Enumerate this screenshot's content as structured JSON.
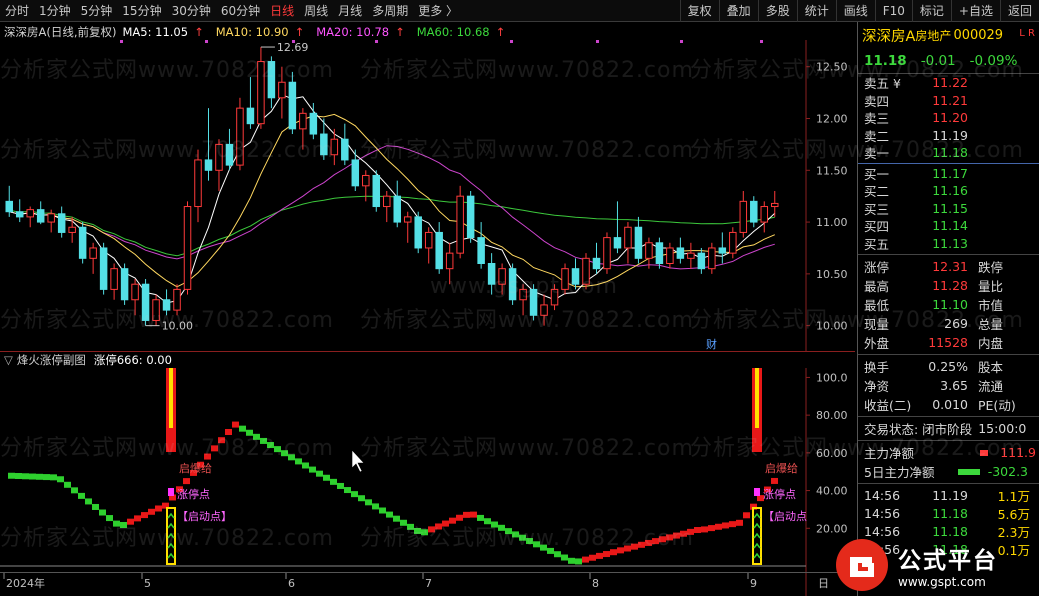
{
  "toolbar": {
    "periods": [
      "分时",
      "1分钟",
      "5分钟",
      "15分钟",
      "30分钟",
      "60分钟",
      "日线",
      "周线",
      "月线",
      "多周期",
      "更多 〉"
    ],
    "active_period": "日线",
    "buttons": [
      "复权",
      "叠加",
      "多股",
      "统计",
      "画线",
      "F10",
      "标记",
      "+自选",
      "返回"
    ]
  },
  "main_chart": {
    "title": "深深房A(日线,前复权)",
    "ma5": "MA5: 11.05",
    "ma10": "MA10: 10.90",
    "ma20": "MA20: 10.78",
    "ma60": "MA60: 10.68",
    "up_arrow": "↑",
    "high_label": "12.69",
    "low_label": "10.00",
    "tag_label": "财",
    "y_ticks": [
      "12.50",
      "12.00",
      "11.50",
      "11.00",
      "10.50",
      "10.00"
    ]
  },
  "sub_chart": {
    "title": "烽火涨停副图",
    "value": "涨停666: 0.00",
    "y_ticks": [
      "100.0",
      "80.00",
      "60.00",
      "40.00",
      "20.00"
    ],
    "labels": {
      "ignite": "启爆给",
      "limit": "涨停点",
      "start": "【启动点】",
      "ignite2": "启爆给",
      "limit2": "涨停点",
      "start2": "【启动点"
    }
  },
  "x_axis": {
    "labels": [
      "2024年",
      "5",
      "6",
      "7",
      "8",
      "9"
    ],
    "corner": "日"
  },
  "watermarks": [
    "分析家公式网www.70822.com",
    "www.gsgpt.com"
  ],
  "stock": {
    "name": "深深房A",
    "industry": "房地产",
    "code": "000029",
    "lr": "L R",
    "price": "11.18",
    "change": "-0.01",
    "change_pct": "-0.09%"
  },
  "order_book": {
    "asks": [
      {
        "label": "卖五 ¥",
        "price": "11.22",
        "vol": ""
      },
      {
        "label": "卖四",
        "price": "11.21",
        "vol": ""
      },
      {
        "label": "卖三",
        "price": "11.20",
        "vol": ""
      },
      {
        "label": "卖二",
        "price": "11.19",
        "vol": ""
      },
      {
        "label": "卖一",
        "price": "11.18",
        "vol": ""
      }
    ],
    "bids": [
      {
        "label": "买一",
        "price": "11.17",
        "vol": ""
      },
      {
        "label": "买二",
        "price": "11.16",
        "vol": ""
      },
      {
        "label": "买三",
        "price": "11.15",
        "vol": ""
      },
      {
        "label": "买四",
        "price": "11.14",
        "vol": ""
      },
      {
        "label": "买五",
        "price": "11.13",
        "vol": ""
      }
    ]
  },
  "stats": [
    {
      "l": "涨停",
      "v": "12.31",
      "r": "跌停",
      "c": "red"
    },
    {
      "l": "最高",
      "v": "11.28",
      "r": "量比",
      "c": "red"
    },
    {
      "l": "最低",
      "v": "11.10",
      "r": "市值",
      "c": "green"
    },
    {
      "l": "现量",
      "v": "269",
      "r": "总量",
      "c": "white"
    },
    {
      "l": "外盘",
      "v": "11528",
      "r": "内盘",
      "c": "red"
    }
  ],
  "stats2": [
    {
      "l": "换手",
      "v": "0.25%",
      "r": "股本",
      "c": "white"
    },
    {
      "l": "净资",
      "v": "3.65",
      "r": "流通",
      "c": "white"
    },
    {
      "l": "收益(二)",
      "v": "0.010",
      "r": "PE(动)",
      "c": "white"
    }
  ],
  "status": {
    "label": "交易状态: 闭市阶段",
    "time": "15:00:0"
  },
  "flows": [
    {
      "label": "主力净额",
      "value": "111.9",
      "c": "red"
    },
    {
      "label": "5日主力净额",
      "value": "-302.3",
      "c": "green"
    }
  ],
  "trades": [
    {
      "t": "14:56",
      "p": "11.19",
      "v": "1.1万",
      "pc": "white",
      "vc": "yellow"
    },
    {
      "t": "14:56",
      "p": "11.18",
      "v": "5.6万",
      "pc": "green",
      "vc": "yellow"
    },
    {
      "t": "14:56",
      "p": "11.18",
      "v": "2.3万",
      "pc": "green",
      "vc": "yellow"
    },
    {
      "t": "14:56",
      "p": "11.18",
      "v": "0.1万",
      "pc": "green",
      "vc": "yellow"
    }
  ],
  "logo": {
    "main": "公式平台",
    "sub": "www.gspt.com"
  },
  "colors": {
    "up": "#ff3a3a",
    "down": "#54e0e6",
    "ma5": "#ffffff",
    "ma10": "#ffd860",
    "ma20": "#cc44cc",
    "ma60": "#3cc83c",
    "accent": "#ffd800"
  },
  "chart_data": {
    "type": "candlestick",
    "title": "深深房A(日线,前复权)",
    "ylim": [
      9.9,
      12.7
    ],
    "ohlc": [
      [
        11.2,
        11.35,
        11.05,
        11.1
      ],
      [
        11.1,
        11.22,
        11.0,
        11.05
      ],
      [
        11.05,
        11.15,
        10.95,
        11.12
      ],
      [
        11.12,
        11.2,
        10.98,
        11.0
      ],
      [
        11.0,
        11.12,
        10.9,
        11.08
      ],
      [
        11.08,
        11.15,
        10.85,
        10.9
      ],
      [
        10.9,
        11.05,
        10.8,
        10.95
      ],
      [
        10.95,
        11.0,
        10.6,
        10.65
      ],
      [
        10.65,
        10.8,
        10.5,
        10.75
      ],
      [
        10.75,
        10.8,
        10.3,
        10.35
      ],
      [
        10.35,
        10.6,
        10.25,
        10.55
      ],
      [
        10.55,
        10.6,
        10.2,
        10.25
      ],
      [
        10.25,
        10.45,
        10.1,
        10.4
      ],
      [
        10.4,
        10.45,
        10.0,
        10.05
      ],
      [
        10.05,
        10.3,
        10.0,
        10.25
      ],
      [
        10.25,
        10.35,
        10.1,
        10.15
      ],
      [
        10.15,
        10.4,
        10.1,
        10.35
      ],
      [
        10.35,
        11.2,
        10.3,
        11.15
      ],
      [
        11.15,
        11.7,
        11.0,
        11.6
      ],
      [
        11.6,
        12.1,
        11.4,
        11.5
      ],
      [
        11.5,
        11.8,
        11.3,
        11.75
      ],
      [
        11.75,
        11.9,
        11.5,
        11.55
      ],
      [
        11.55,
        12.2,
        11.5,
        12.1
      ],
      [
        12.1,
        12.4,
        11.9,
        11.95
      ],
      [
        11.95,
        12.69,
        11.9,
        12.55
      ],
      [
        12.55,
        12.6,
        12.1,
        12.2
      ],
      [
        12.2,
        12.5,
        12.0,
        12.35
      ],
      [
        12.35,
        12.45,
        11.85,
        11.9
      ],
      [
        11.9,
        12.1,
        11.7,
        12.05
      ],
      [
        12.05,
        12.15,
        11.8,
        11.85
      ],
      [
        11.85,
        12.0,
        11.6,
        11.65
      ],
      [
        11.65,
        11.9,
        11.55,
        11.8
      ],
      [
        11.8,
        11.95,
        11.55,
        11.6
      ],
      [
        11.6,
        11.7,
        11.3,
        11.35
      ],
      [
        11.35,
        11.5,
        11.2,
        11.45
      ],
      [
        11.45,
        11.5,
        11.1,
        11.15
      ],
      [
        11.15,
        11.3,
        11.0,
        11.25
      ],
      [
        11.25,
        11.4,
        10.95,
        11.0
      ],
      [
        11.0,
        11.1,
        10.8,
        11.05
      ],
      [
        11.05,
        11.1,
        10.7,
        10.75
      ],
      [
        10.75,
        10.95,
        10.6,
        10.9
      ],
      [
        10.9,
        11.0,
        10.5,
        10.55
      ],
      [
        10.55,
        10.8,
        10.4,
        10.7
      ],
      [
        10.7,
        11.35,
        10.65,
        11.25
      ],
      [
        11.25,
        11.3,
        10.8,
        10.85
      ],
      [
        10.85,
        11.0,
        10.55,
        10.6
      ],
      [
        10.6,
        10.7,
        10.3,
        10.4
      ],
      [
        10.4,
        10.6,
        10.3,
        10.55
      ],
      [
        10.55,
        10.6,
        10.2,
        10.25
      ],
      [
        10.25,
        10.4,
        10.1,
        10.35
      ],
      [
        10.35,
        10.4,
        10.05,
        10.1
      ],
      [
        10.1,
        10.3,
        10.0,
        10.2
      ],
      [
        10.2,
        10.4,
        10.15,
        10.35
      ],
      [
        10.35,
        10.6,
        10.3,
        10.55
      ],
      [
        10.55,
        10.65,
        10.35,
        10.4
      ],
      [
        10.4,
        10.7,
        10.35,
        10.65
      ],
      [
        10.65,
        10.8,
        10.5,
        10.55
      ],
      [
        10.55,
        10.9,
        10.5,
        10.85
      ],
      [
        10.85,
        11.2,
        10.7,
        10.75
      ],
      [
        10.75,
        11.0,
        10.6,
        10.95
      ],
      [
        10.95,
        11.05,
        10.6,
        10.65
      ],
      [
        10.65,
        10.85,
        10.55,
        10.8
      ],
      [
        10.8,
        10.85,
        10.55,
        10.6
      ],
      [
        10.6,
        10.8,
        10.55,
        10.75
      ],
      [
        10.75,
        10.85,
        10.6,
        10.65
      ],
      [
        10.65,
        10.8,
        10.55,
        10.7
      ],
      [
        10.7,
        10.75,
        10.5,
        10.55
      ],
      [
        10.55,
        10.8,
        10.5,
        10.75
      ],
      [
        10.75,
        10.9,
        10.6,
        10.7
      ],
      [
        10.7,
        10.95,
        10.65,
        10.9
      ],
      [
        10.9,
        11.3,
        10.85,
        11.2
      ],
      [
        11.2,
        11.25,
        10.95,
        11.0
      ],
      [
        11.0,
        11.2,
        10.9,
        11.15
      ],
      [
        11.15,
        11.3,
        11.05,
        11.18
      ]
    ]
  }
}
